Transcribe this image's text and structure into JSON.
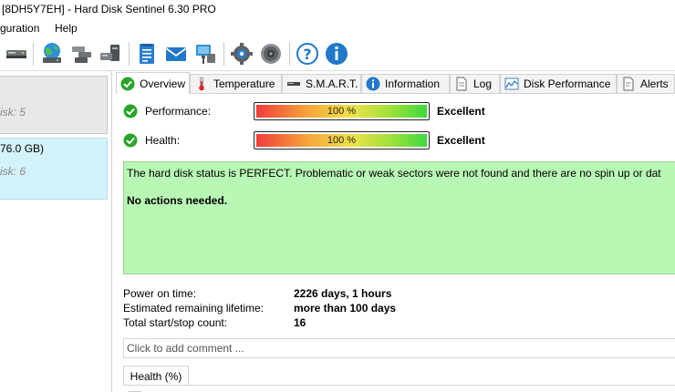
{
  "window": {
    "title": "[8DH5Y7EH]  -  Hard Disk Sentinel 6.30 PRO"
  },
  "menu": {
    "configuration": "guration",
    "help": "Help"
  },
  "toolbar": {
    "icons": [
      "disk-icon",
      "globe-disk-icon",
      "network-drives-icon",
      "drive-computer-icon",
      "report-icon",
      "mail-icon",
      "computer-network-icon",
      "settings-gear-icon",
      "speaker-icon",
      "help-icon",
      "info-icon"
    ]
  },
  "disks": [
    {
      "sub": "isk: 5"
    },
    {
      "size": "76.0 GB)",
      "sub": "isk: 6"
    }
  ],
  "tabs": [
    {
      "label": "Overview",
      "icon": "check-icon"
    },
    {
      "label": "Temperature",
      "icon": "thermometer-icon"
    },
    {
      "label": "S.M.A.R.T.",
      "icon": "smart-icon"
    },
    {
      "label": "Information",
      "icon": "info-icon"
    },
    {
      "label": "Log",
      "icon": "log-icon"
    },
    {
      "label": "Disk Performance",
      "icon": "chart-icon"
    },
    {
      "label": "Alerts",
      "icon": "alerts-icon"
    }
  ],
  "overview": {
    "performance": {
      "label": "Performance:",
      "percent": 100,
      "percent_text": "100 %",
      "rating": "Excellent"
    },
    "health": {
      "label": "Health:",
      "percent": 100,
      "percent_text": "100 %",
      "rating": "Excellent"
    },
    "status_text": "The hard disk status is PERFECT. Problematic or weak sectors were not found and there are no spin up or dat",
    "action_text": "No actions needed.",
    "info": [
      {
        "key": "Power on time:",
        "value": "2226 days, 1 hours"
      },
      {
        "key": "Estimated remaining lifetime:",
        "value": "more than 100 days"
      },
      {
        "key": "Total start/stop count:",
        "value": "16"
      }
    ],
    "comment_placeholder": "Click to add comment ...",
    "chart_tab": "Health (%)"
  },
  "colors": {
    "status_bg": "#b9f7b5",
    "selected_disk_bg": "#d4f2fb",
    "check_green": "#2aa52a"
  }
}
